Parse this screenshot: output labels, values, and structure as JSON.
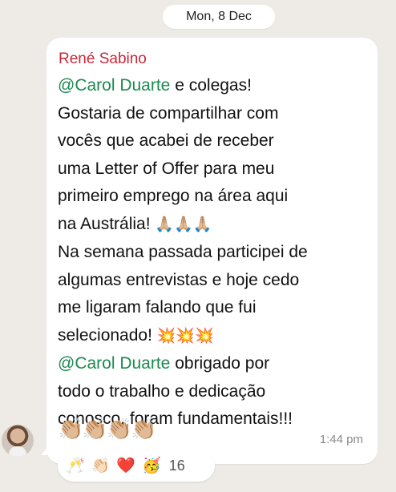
{
  "date_label": "Mon, 8 Dec",
  "message": {
    "sender": "René Sabino",
    "lines": [
      {
        "mention": "@Carol Duarte",
        "text": " e colegas!"
      },
      {
        "text": "Gostaria de compartilhar com"
      },
      {
        "text": "vocês que acabei de receber"
      },
      {
        "text": "uma Letter of Offer para meu"
      },
      {
        "text": "primeiro emprego na área aqui"
      },
      {
        "text": "na Austrália! ",
        "emoji": "🙏🏼🙏🏼🙏🏼"
      },
      {
        "text": "Na semana passada participei de"
      },
      {
        "text": "algumas entrevistas e hoje cedo"
      },
      {
        "text": "me ligaram falando que fui"
      },
      {
        "text": "selecionado! ",
        "emoji": "💥💥💥"
      },
      {
        "mention": "@Carol Duarte",
        "text": " obrigado por"
      },
      {
        "text": "todo o trabalho e dedicação"
      },
      {
        "text": "conosco, foram fundamentais!!!"
      }
    ],
    "clap_emoji": "👏🏼👏🏼👏🏼👏🏼",
    "time": "1:44 pm"
  },
  "reactions": {
    "items": [
      "🥂",
      "👏🏻",
      "❤️",
      "🥳"
    ],
    "count": "16"
  },
  "colors": {
    "background": "#eeebe6",
    "sender": "#c8283a",
    "mention": "#1a8a4f",
    "bubble": "#ffffff"
  }
}
